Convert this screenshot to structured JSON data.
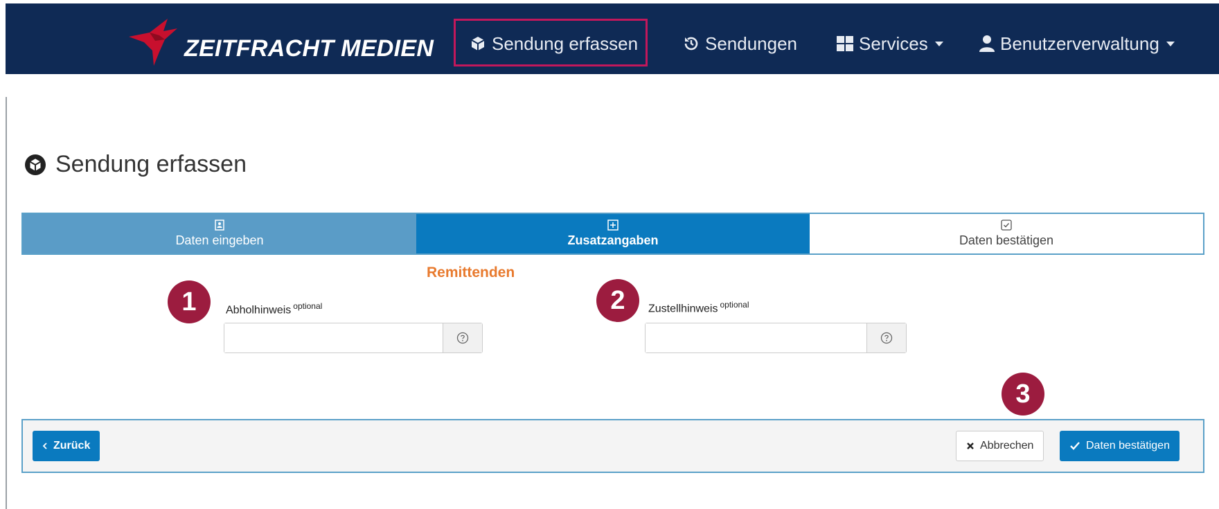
{
  "brand": {
    "name": "ZEITFRACHT MEDIEN"
  },
  "nav": {
    "items": [
      {
        "label": "Sendung erfassen",
        "icon": "cube-icon",
        "active": true
      },
      {
        "label": "Sendungen",
        "icon": "history-icon"
      },
      {
        "label": "Services",
        "icon": "grid-icon",
        "dropdown": true
      },
      {
        "label": "Benutzerverwaltung",
        "icon": "user-icon",
        "dropdown": true
      }
    ]
  },
  "page": {
    "title": "Sendung erfassen"
  },
  "steps": [
    {
      "label": "Daten eingeben",
      "icon": "address-book-icon",
      "state": "done"
    },
    {
      "label": "Zusatzangaben",
      "icon": "plus-square-icon",
      "state": "active"
    },
    {
      "label": "Daten bestätigen",
      "icon": "check-square-icon",
      "state": "pending"
    }
  ],
  "section": {
    "title": "Remittenden"
  },
  "fields": {
    "pickup": {
      "label": "Abholhinweis",
      "optional": "optional",
      "value": ""
    },
    "delivery": {
      "label": "Zustellhinweis",
      "optional": "optional",
      "value": ""
    }
  },
  "badges": [
    "1",
    "2",
    "3"
  ],
  "footer": {
    "back_label": "Zurück",
    "cancel_label": "Abbrechen",
    "confirm_label": "Daten bestätigen"
  },
  "colors": {
    "navbar": "#0f2a55",
    "primary": "#0a7abf",
    "accent_orange": "#e87a2e",
    "badge": "#9c1c3f",
    "highlight": "#c2185b"
  }
}
